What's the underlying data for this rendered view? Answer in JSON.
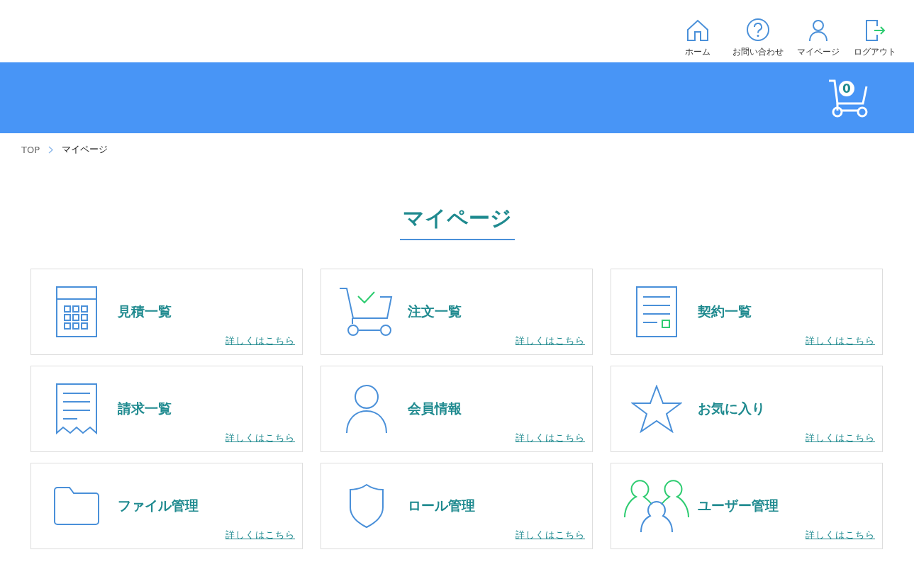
{
  "top_nav": [
    {
      "kind": "home",
      "label": "ホーム"
    },
    {
      "kind": "help",
      "label": "お問い合わせ"
    },
    {
      "kind": "user",
      "label": "マイページ"
    },
    {
      "kind": "logout",
      "label": "ログアウト"
    }
  ],
  "cart": {
    "count": "0"
  },
  "breadcrumb": [
    {
      "label": "TOP",
      "selected": false
    },
    {
      "label": "マイページ",
      "selected": true
    }
  ],
  "page_title": "マイページ",
  "cards": [
    {
      "kind": "calculator",
      "title": "見積一覧",
      "link": "詳しくはこちら"
    },
    {
      "kind": "cart",
      "title": "注文一覧",
      "link": "詳しくはこちら"
    },
    {
      "kind": "document",
      "title": "契約一覧",
      "link": "詳しくはこちら"
    },
    {
      "kind": "receipt",
      "title": "請求一覧",
      "link": "詳しくはこちら"
    },
    {
      "kind": "person",
      "title": "会員情報",
      "link": "詳しくはこちら"
    },
    {
      "kind": "star",
      "title": "お気に入り",
      "link": "詳しくはこちら"
    },
    {
      "kind": "folder",
      "title": "ファイル管理",
      "link": "詳しくはこちら"
    },
    {
      "kind": "shield",
      "title": "ロール管理",
      "link": "詳しくはこちら"
    },
    {
      "kind": "users",
      "title": "ユーザー管理",
      "link": "詳しくはこちら"
    }
  ]
}
